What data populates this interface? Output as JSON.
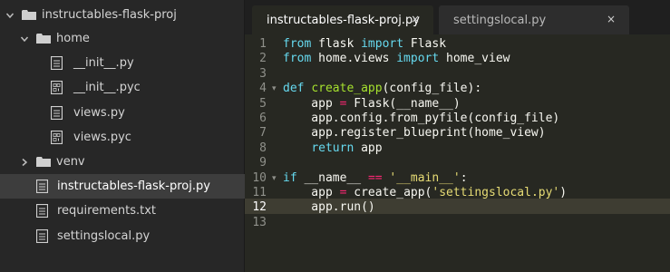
{
  "sidebar": {
    "items": [
      {
        "label": "instructables-flask-proj",
        "type": "folder",
        "expanded": true,
        "depth": 0
      },
      {
        "label": "home",
        "type": "folder",
        "expanded": true,
        "depth": 1
      },
      {
        "label": "__init__.py",
        "type": "file",
        "depth": 2
      },
      {
        "label": "__init__.pyc",
        "type": "binary-file",
        "depth": 2
      },
      {
        "label": "views.py",
        "type": "file",
        "depth": 2
      },
      {
        "label": "views.pyc",
        "type": "binary-file",
        "depth": 2
      },
      {
        "label": "venv",
        "type": "folder",
        "expanded": false,
        "depth": 1
      },
      {
        "label": "instructables-flask-proj.py",
        "type": "file",
        "depth": 1,
        "selected": true
      },
      {
        "label": "requirements.txt",
        "type": "file",
        "depth": 1
      },
      {
        "label": "settingslocal.py",
        "type": "file",
        "depth": 1
      }
    ]
  },
  "tabs": [
    {
      "label": "instructables-flask-proj.py",
      "active": true,
      "close": "×"
    },
    {
      "label": "settingslocal.py",
      "active": false,
      "close": "×"
    }
  ],
  "editor": {
    "current_line": 12,
    "lines": [
      {
        "n": "1",
        "tokens": [
          [
            "kw",
            "from"
          ],
          [
            "pl",
            " flask "
          ],
          [
            "kw",
            "import"
          ],
          [
            "pl",
            " Flask"
          ]
        ]
      },
      {
        "n": "2",
        "tokens": [
          [
            "kw",
            "from"
          ],
          [
            "pl",
            " home.views "
          ],
          [
            "kw",
            "import"
          ],
          [
            "pl",
            " home_view"
          ]
        ]
      },
      {
        "n": "3",
        "tokens": []
      },
      {
        "n": "4",
        "fold": "▾",
        "tokens": [
          [
            "kw",
            "def"
          ],
          [
            "pl",
            " "
          ],
          [
            "fn",
            "create_app"
          ],
          [
            "pl",
            "(config_file):"
          ]
        ]
      },
      {
        "n": "5",
        "tokens": [
          [
            "pl",
            "    app "
          ],
          [
            "op",
            "="
          ],
          [
            "pl",
            " Flask(__name__)"
          ]
        ]
      },
      {
        "n": "6",
        "tokens": [
          [
            "pl",
            "    app.config.from_pyfile(config_file)"
          ]
        ]
      },
      {
        "n": "7",
        "tokens": [
          [
            "pl",
            "    app.register_blueprint(home_view)"
          ]
        ]
      },
      {
        "n": "8",
        "tokens": [
          [
            "pl",
            "    "
          ],
          [
            "kw",
            "return"
          ],
          [
            "pl",
            " app"
          ]
        ]
      },
      {
        "n": "9",
        "tokens": []
      },
      {
        "n": "10",
        "fold": "▾",
        "tokens": [
          [
            "kw",
            "if"
          ],
          [
            "pl",
            " __name__ "
          ],
          [
            "op",
            "=="
          ],
          [
            "pl",
            " "
          ],
          [
            "str",
            "'__main__'"
          ],
          [
            "pl",
            ":"
          ]
        ]
      },
      {
        "n": "11",
        "tokens": [
          [
            "pl",
            "    app "
          ],
          [
            "op",
            "="
          ],
          [
            "pl",
            " create_app("
          ],
          [
            "str",
            "'settingslocal.py'"
          ],
          [
            "pl",
            ")"
          ]
        ]
      },
      {
        "n": "12",
        "tokens": [
          [
            "pl",
            "    app.run()"
          ]
        ]
      },
      {
        "n": "13",
        "tokens": []
      }
    ]
  },
  "colors": {
    "keyword": "#66d9ef",
    "function": "#a6e22e",
    "string": "#e6db74",
    "operator": "#f92672",
    "text": "#f8f8f2",
    "background": "#272822"
  },
  "icons": {
    "folder": "folder-icon",
    "file": "file-icon",
    "binary": "binary-file-icon",
    "close": "close-icon"
  }
}
